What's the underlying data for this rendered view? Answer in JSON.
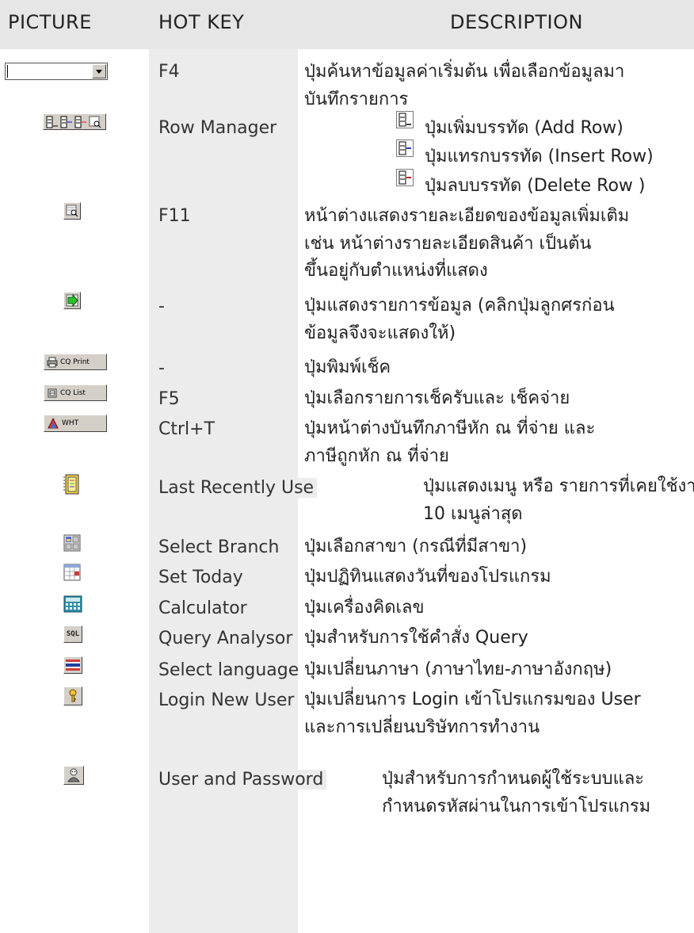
{
  "header": {
    "picture": "PICTURE",
    "hot_key": "HOT  KEY",
    "description": "DESCRIPTION"
  },
  "rows": [
    {
      "icon": "dropdown-combo-icon",
      "hotkey": "F4",
      "desc": [
        "ปุ่มค้นหาข้อมูลค่าเริ่มต้น เพื่อเลือกข้อมูลมา",
        "บันทึกรายการ"
      ]
    },
    {
      "icon": "row-manager-icons",
      "hotkey": "Row Manager",
      "desc": []
    },
    {
      "icon": "detail-window-icon",
      "hotkey": "F11",
      "desc": [
        "หน้าต่างแสดงรายละเอียดของข้อมูลเพิ่มเติม",
        "เช่น หน้าต่างรายละเอียดสินค้า เป็นต้น",
        "ขึ้นอยู่กับตำแหน่งที่แสดง"
      ]
    },
    {
      "icon": "show-list-arrow-icon",
      "hotkey": "-",
      "desc": [
        "ปุ่มแสดงรายการข้อมูล (คลิกปุ่มลูกศรก่อน",
        "ข้อมูลจึงจะแสดงให้)"
      ]
    },
    {
      "icon": "cq-print-button",
      "button_text": "CQ Print",
      "hotkey": "-",
      "desc": [
        "ปุ่มพิมพ์เช็ค"
      ]
    },
    {
      "icon": "cq-list-button",
      "button_text": "CQ List",
      "hotkey": "F5",
      "desc": [
        "ปุ่มเลือกรายการเช็ครับและ เช็คจ่าย"
      ]
    },
    {
      "icon": "wht-button",
      "button_text": "WHT",
      "hotkey": "Ctrl+T",
      "desc": [
        "ปุ่มหน้าต่างบันทึกภาษีหัก ณ ที่จ่าย และ",
        "ภาษีถูกหัก  ณ ที่จ่าย"
      ]
    },
    {
      "icon": "last-recently-use-icon",
      "hotkey": "Last Recently Use",
      "desc": [
        "ปุ่มแสดงเมนู หรือ รายการที่เคยใช้งาน",
        "10 เมนูล่าสุด"
      ]
    },
    {
      "icon": "select-branch-icon",
      "hotkey": "Select Branch",
      "desc": [
        "ปุ่มเลือกสาขา (กรณีที่มีสาขา)"
      ]
    },
    {
      "icon": "set-today-icon",
      "hotkey": "Set Today",
      "desc": [
        "ปุ่มปฏิทินแสดงวันที่ของโปรแกรม"
      ]
    },
    {
      "icon": "calculator-icon",
      "hotkey": "Calculator",
      "desc": [
        "ปุ่มเครื่องคิดเลข"
      ]
    },
    {
      "icon": "sql-icon",
      "icon_text": "SQL",
      "hotkey": "Query Analysor",
      "desc": [
        "ปุ่มสำหรับการใช้คำสั่ง Query"
      ]
    },
    {
      "icon": "thai-flag-icon",
      "hotkey": "Select language",
      "desc": [
        "ปุ่มเปลี่ยนภาษา (ภาษาไทย-ภาษาอังกฤษ)"
      ]
    },
    {
      "icon": "key-icon",
      "hotkey": "Login New User",
      "desc": [
        "ปุ่มเปลี่ยนการ Login เข้าโปรแกรมของ User",
        " และการเปลี่ยนบริษัทการทำงาน"
      ]
    },
    {
      "icon": "user-password-icon",
      "hotkey": "User and Password",
      "desc": [
        "ปุ่มสำหรับการกำหนดผู้ใช้ระบบและ",
        "กำหนดรหัสผ่านในการเข้าโปรแกรม"
      ]
    }
  ],
  "row_manager_items": [
    {
      "icon": "add-row-icon",
      "label": "ปุ่มเพิ่มบรรทัด (Add Row)"
    },
    {
      "icon": "insert-row-icon",
      "label": "ปุ่มแทรกบรรทัด (Insert Row)"
    },
    {
      "icon": "delete-row-icon",
      "label": "ปุ่มลบบรรทัด (Delete Row )"
    }
  ]
}
